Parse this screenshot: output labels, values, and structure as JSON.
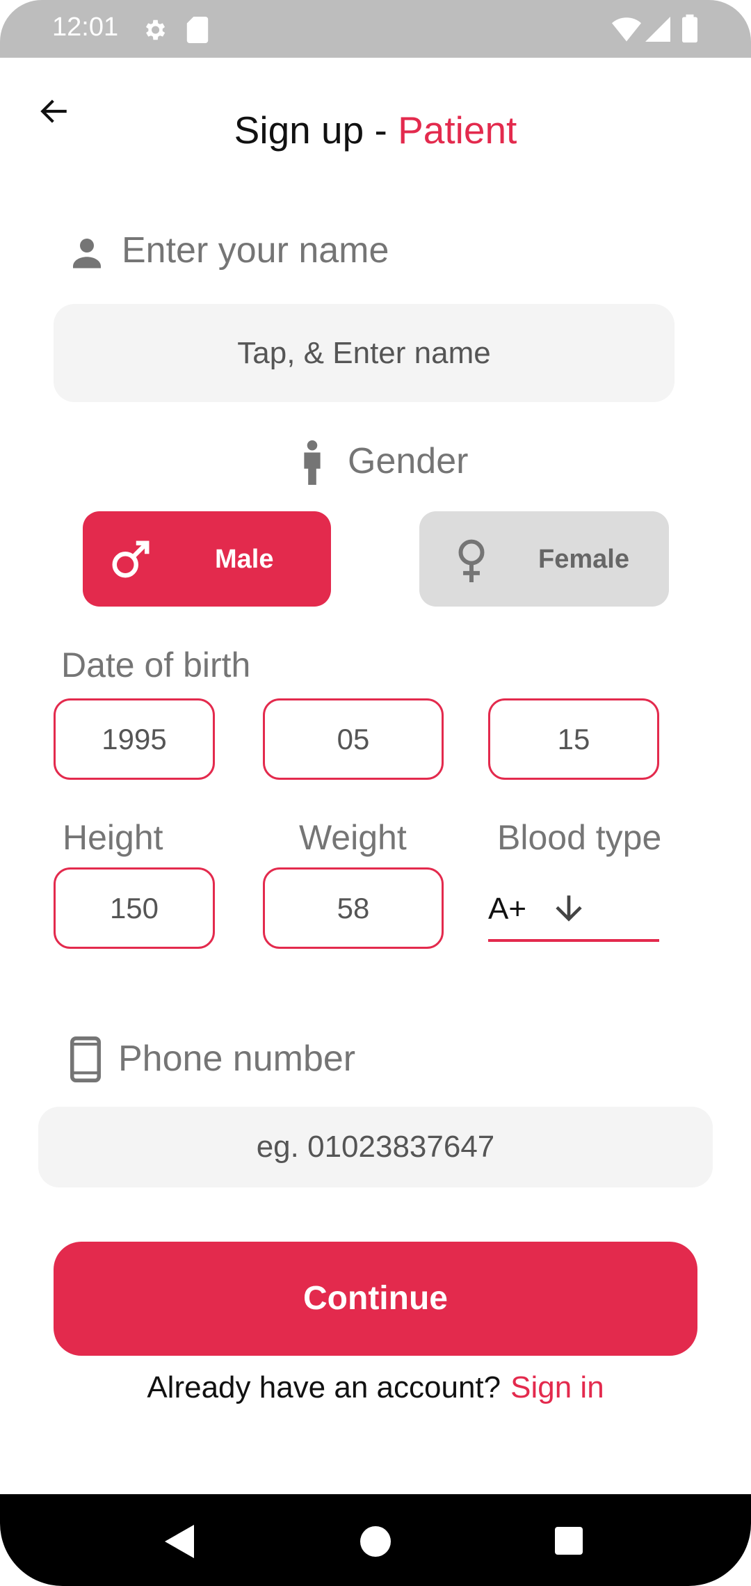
{
  "status_bar": {
    "time": "12:01",
    "icons": [
      "gear-icon",
      "sd-card-icon",
      "wifi-icon",
      "signal-icon",
      "battery-icon"
    ]
  },
  "header": {
    "back_icon": "arrow-back-icon",
    "title_prefix": "Sign up - ",
    "title_accent": "Patient"
  },
  "name_section": {
    "label": "Enter your name",
    "icon": "person-icon",
    "placeholder": "Tap,  & Enter name"
  },
  "gender_section": {
    "label": "Gender",
    "icon": "person-standing-icon",
    "options": [
      {
        "label": "Male",
        "icon": "male-icon",
        "selected": true
      },
      {
        "label": "Female",
        "icon": "female-icon",
        "selected": false
      }
    ]
  },
  "dob_section": {
    "label": "Date of birth",
    "year": "1995",
    "month": "05",
    "day": "15"
  },
  "measures": {
    "height_label": "Height",
    "height_value": "150",
    "weight_label": "Weight",
    "weight_value": "58",
    "blood_label": "Blood type",
    "blood_value": "A+"
  },
  "phone_section": {
    "label": "Phone number",
    "icon": "phone-icon",
    "placeholder": "eg. 01023837647"
  },
  "actions": {
    "continue_label": "Continue",
    "account_prompt": "Already have an account?",
    "signin_label": "Sign in"
  },
  "colors": {
    "accent": "#e32a4d",
    "muted": "#757575",
    "field_bg": "#f4f4f4",
    "inactive_btn": "#dcdcdc"
  }
}
